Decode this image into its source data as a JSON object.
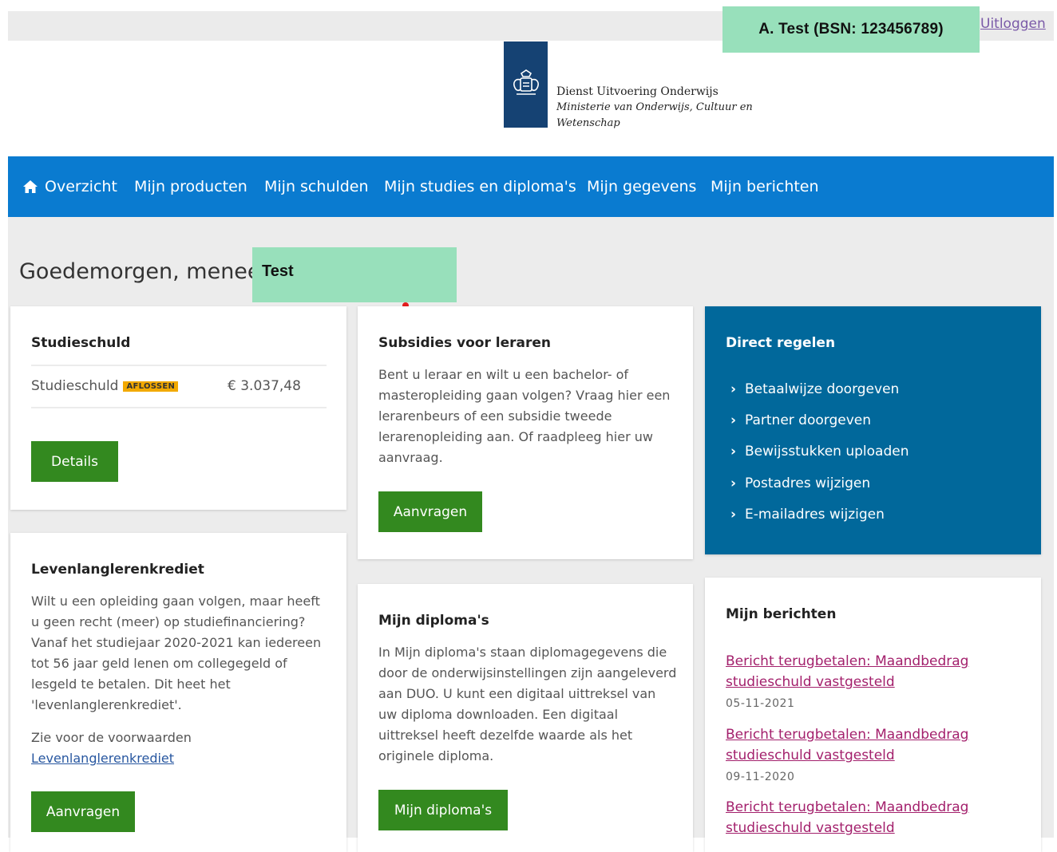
{
  "header": {
    "user_label": "A. Test (BSN: 123456789)",
    "logout_label": "Uitloggen",
    "org_name": "Dienst Uitvoering Onderwijs",
    "ministry_line1": "Ministerie van Onderwijs, Cultuur en",
    "ministry_line2": "Wetenschap"
  },
  "nav": {
    "items": [
      {
        "label": "Overzicht",
        "icon": "home-icon"
      },
      {
        "label": "Mijn producten"
      },
      {
        "label": "Mijn schulden"
      },
      {
        "label": "Mijn studies en diploma's"
      },
      {
        "label": "Mijn gegevens"
      },
      {
        "label": "Mijn berichten"
      }
    ]
  },
  "greeting": {
    "text": "Goedemorgen, meneer",
    "name": "Test"
  },
  "studieschuld": {
    "title": "Studieschuld",
    "row_label": "Studieschuld",
    "badge": "AFLOSSEN",
    "amount": "€ 3.037,48",
    "button": "Details"
  },
  "subsidies": {
    "title": "Subsidies voor leraren",
    "text": "Bent u leraar en wilt u een bachelor- of masteropleiding gaan volgen? Vraag hier een lerarenbeurs of een subsidie tweede lerarenopleiding aan. Of raadpleeg hier uw aanvraag.",
    "button": "Aanvragen"
  },
  "direct": {
    "title": "Direct regelen",
    "items": [
      "Betaalwijze doorgeven",
      "Partner doorgeven",
      "Bewijsstukken uploaden",
      "Postadres wijzigen",
      "E-mailadres wijzigen"
    ]
  },
  "levenlang": {
    "title": "Levenlanglerenkrediet",
    "text": "Wilt u een opleiding gaan volgen, maar heeft u geen recht (meer) op studiefinanciering? Vanaf het studiejaar 2020-2021 kan iedereen tot 56 jaar geld lenen om collegegeld of lesgeld te betalen. Dit heet het 'levenlanglerenkrediet'.",
    "conditions_text": "Zie voor de voorwaarden",
    "conditions_link": "Levenlanglerenkrediet",
    "button": "Aanvragen"
  },
  "diplomas": {
    "title": "Mijn diploma's",
    "text": "In Mijn diploma's staan diplomagegevens die door de onderwijsinstellingen zijn aangeleverd aan DUO. U kunt een digitaal uittreksel van uw diploma downloaden. Een digitaal uittreksel heeft dezelfde waarde als het originele diploma.",
    "button": "Mijn diploma's"
  },
  "berichten": {
    "title": "Mijn berichten",
    "messages": [
      {
        "title": "Bericht terugbetalen: Maandbedrag studieschuld vastgesteld",
        "date": "05-11-2021"
      },
      {
        "title": "Bericht terugbetalen: Maandbedrag studieschuld vastgesteld",
        "date": "09-11-2020"
      },
      {
        "title": "Bericht terugbetalen: Maandbedrag studieschuld vastgesteld",
        "date": ""
      }
    ]
  }
}
